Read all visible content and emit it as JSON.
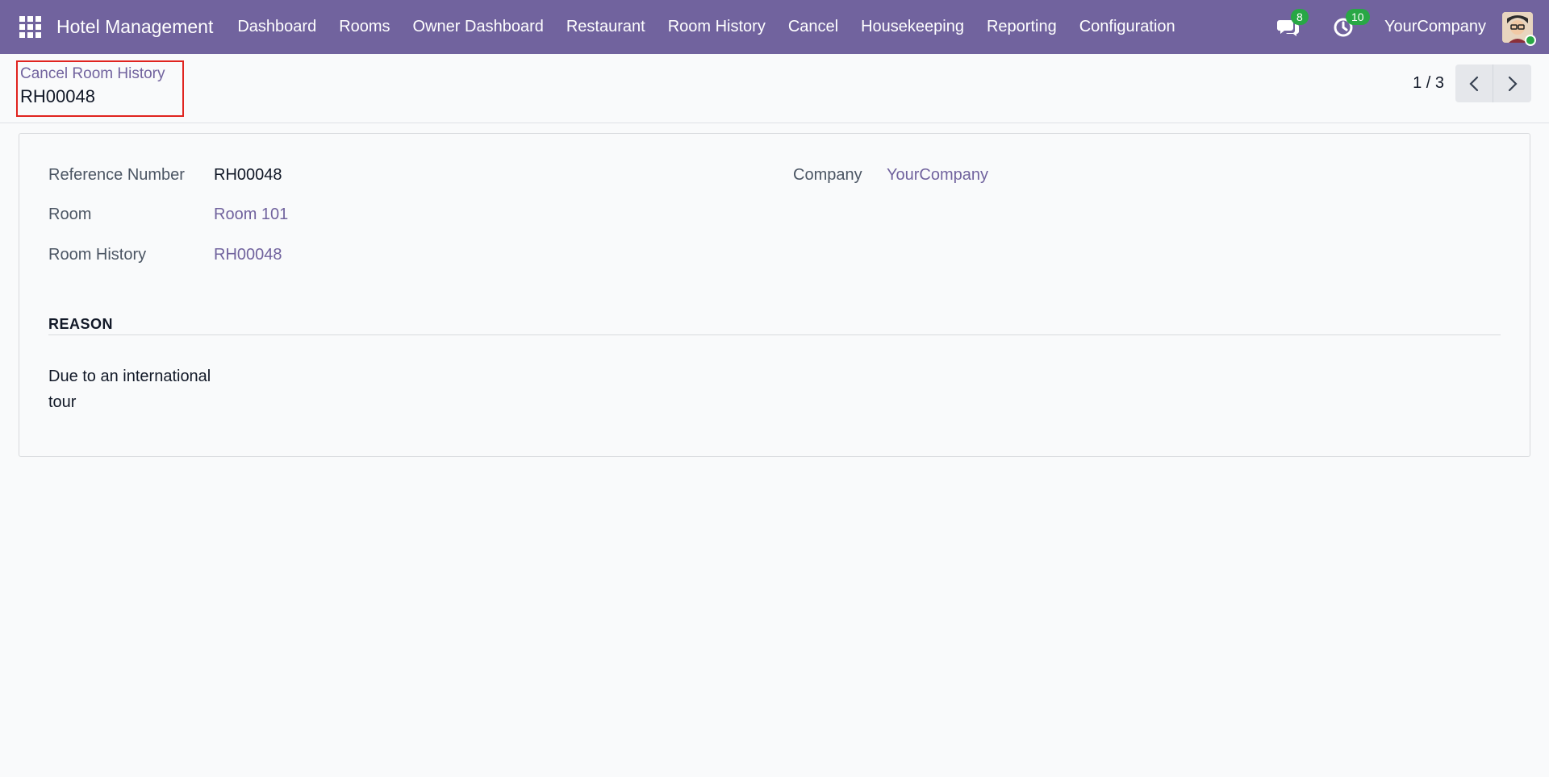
{
  "navbar": {
    "brand": "Hotel Management",
    "menu": [
      "Dashboard",
      "Rooms",
      "Owner Dashboard",
      "Restaurant",
      "Room History",
      "Cancel",
      "Housekeeping",
      "Reporting",
      "Configuration"
    ],
    "messages_count": "8",
    "activities_count": "10",
    "company": "YourCompany",
    "accent_color": "#71639e"
  },
  "breadcrumb": {
    "parent": "Cancel Room History",
    "current": "RH00048"
  },
  "pager": {
    "value": "1 / 3"
  },
  "form": {
    "reference_label": "Reference Number",
    "reference_value": "RH00048",
    "room_label": "Room",
    "room_value": "Room 101",
    "room_history_label": "Room History",
    "room_history_value": "RH00048",
    "company_label": "Company",
    "company_value": "YourCompany",
    "reason_title": "REASON",
    "reason_line1": "Due to an international",
    "reason_line2": "tour"
  }
}
